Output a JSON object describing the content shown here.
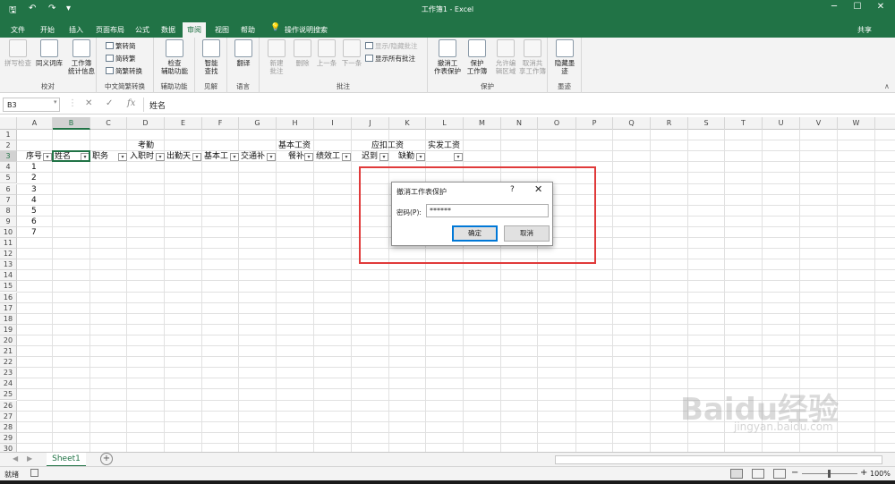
{
  "window": {
    "title": "工作簿1 - Excel",
    "share_label": "共享",
    "tell_me": "操作说明搜索"
  },
  "tabs": [
    "文件",
    "开始",
    "插入",
    "页面布局",
    "公式",
    "数据",
    "审阅",
    "视图",
    "帮助"
  ],
  "active_tab": "审阅",
  "ribbon": {
    "groups": [
      {
        "label": "校对",
        "buttons": [
          "拼写检查",
          "同义词库",
          "工作簿\n统计信息"
        ]
      },
      {
        "label": "中文简繁转换",
        "buttons": [
          "繁转简",
          "简转繁",
          "简繁转换"
        ]
      },
      {
        "label": "辅助功能",
        "buttons": [
          "检查\n辅助功能"
        ]
      },
      {
        "label": "见解",
        "buttons": [
          "智能\n查找"
        ]
      },
      {
        "label": "语言",
        "buttons": [
          "翻译"
        ]
      },
      {
        "label": "批注",
        "buttons": [
          "新建\n批注",
          "删除",
          "上一条",
          "下一条",
          "显示/隐藏批注",
          "显示所有批注"
        ]
      },
      {
        "label": "保护",
        "buttons": [
          "撤消工\n作表保护",
          "保护\n工作簿",
          "允许编\n辑区域",
          "取消共\n享工作簿"
        ]
      },
      {
        "label": "墨迹",
        "buttons": [
          "隐藏墨\n迹"
        ]
      }
    ]
  },
  "formula_bar": {
    "name_box": "B3",
    "formula": "姓名"
  },
  "columns": [
    "A",
    "B",
    "C",
    "D",
    "E",
    "F",
    "G",
    "H",
    "I",
    "J",
    "K",
    "L",
    "M",
    "N",
    "O",
    "P",
    "Q",
    "R",
    "S",
    "T",
    "U",
    "V",
    "W"
  ],
  "rows": [
    "1",
    "2",
    "3",
    "4",
    "5",
    "6",
    "7",
    "8",
    "9",
    "10",
    "11",
    "12",
    "13",
    "14",
    "15",
    "16",
    "17",
    "18",
    "19",
    "20",
    "21",
    "22",
    "23",
    "24",
    "25",
    "26",
    "27",
    "28",
    "29",
    "30"
  ],
  "cells": {
    "row2": {
      "D": "考勤",
      "H": "基本工资",
      "J": "应扣工资",
      "L": "实发工资"
    },
    "row3": [
      "序号",
      "姓名",
      "职务",
      "入职时",
      "出勤天",
      "基本工",
      "交通补",
      "餐补",
      "绩效工",
      "迟到",
      "缺勤"
    ],
    "serials": [
      "1",
      "2",
      "3",
      "4",
      "5",
      "6",
      "7"
    ]
  },
  "dialog": {
    "title": "撤消工作表保护",
    "help": "?",
    "close": "✕",
    "password_label": "密码(P):",
    "password_value": "******",
    "ok": "确定",
    "cancel": "取消"
  },
  "sheet_tab": "Sheet1",
  "status": {
    "ready": "就绪",
    "zoom": "100%"
  },
  "watermark": {
    "brand": "Baidu经验",
    "url": "jingyan.baidu.com"
  }
}
